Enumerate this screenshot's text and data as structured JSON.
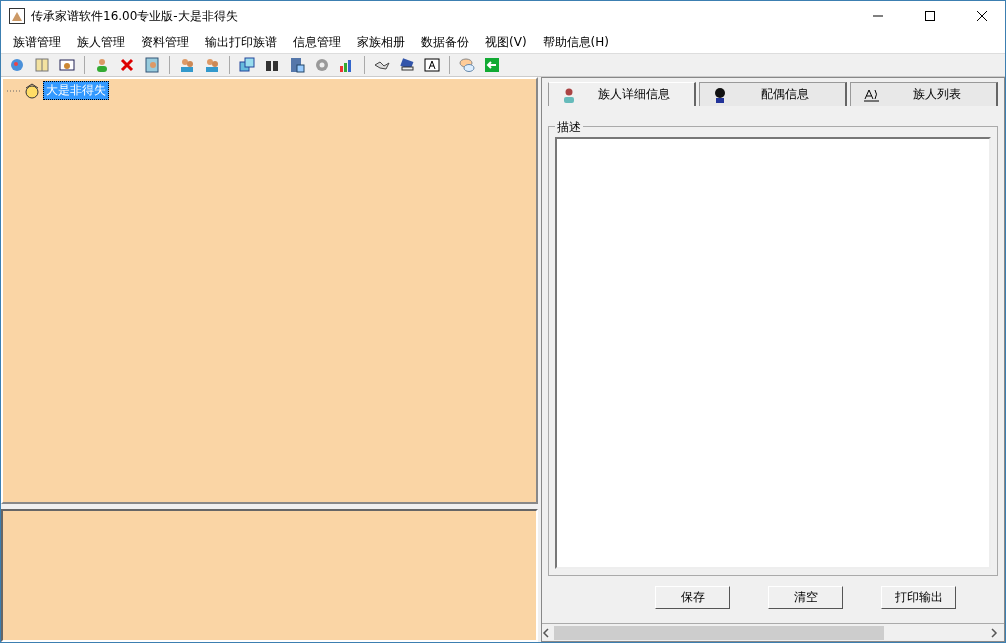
{
  "window": {
    "title": "传承家谱软件16.00专业版-大是非得失"
  },
  "menu": [
    "族谱管理",
    "族人管理",
    "资料管理",
    "输出打印族谱",
    "信息管理",
    "家族相册",
    "数据备份",
    "视图(V)",
    "帮助信息(H)"
  ],
  "tree": [
    {
      "label": "大是非得失",
      "selected": true
    }
  ],
  "tabs": [
    {
      "label": "族人详细信息",
      "kind": "person",
      "selected": true
    },
    {
      "label": "配偶信息",
      "kind": "spouse",
      "selected": false
    },
    {
      "label": "族人列表",
      "kind": "list",
      "selected": false
    }
  ],
  "description": {
    "label": "描述"
  },
  "buttons": [
    "保存",
    "清空",
    "打印输出"
  ]
}
